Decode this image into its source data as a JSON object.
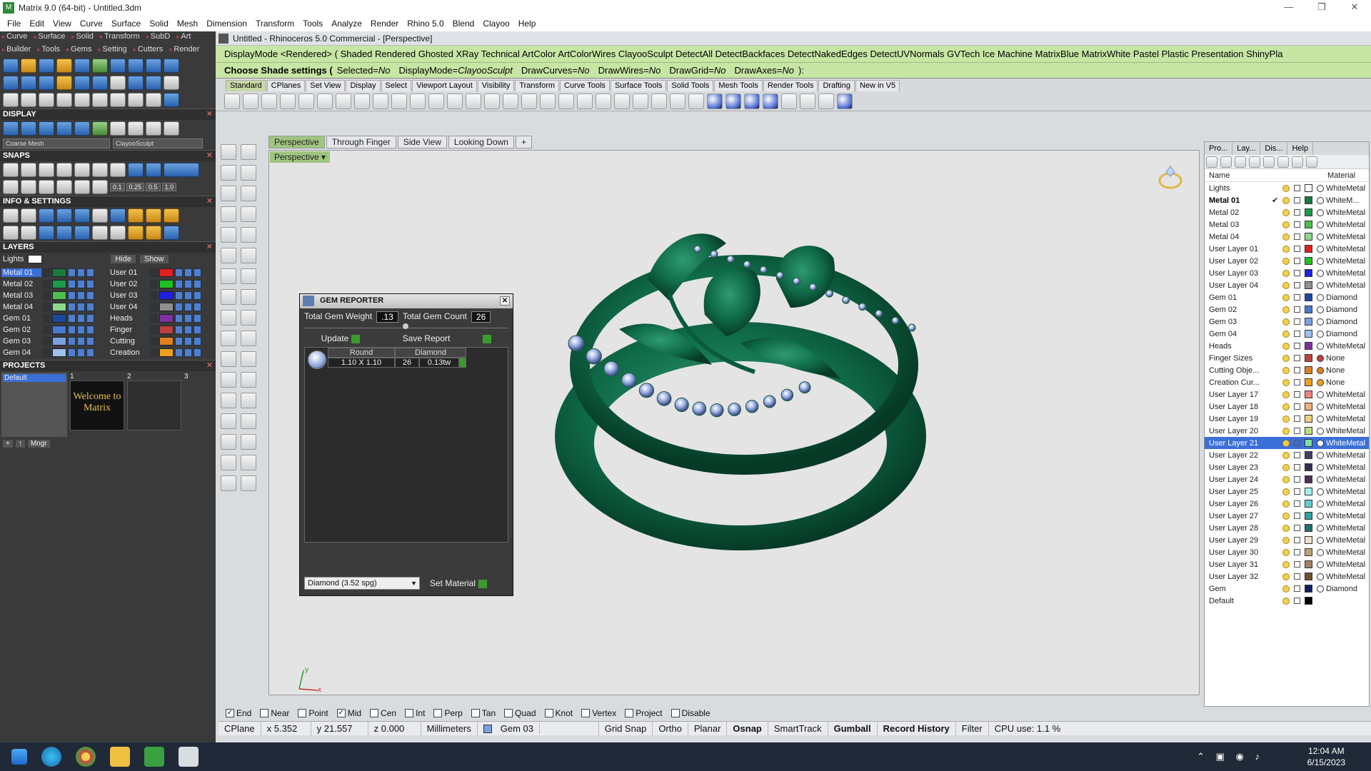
{
  "window": {
    "title": "Matrix 9.0 (64-bit) - Untitled.3dm",
    "minimize": "—",
    "maximize": "❐",
    "close": "✕"
  },
  "menu": [
    "File",
    "Edit",
    "View",
    "Curve",
    "Surface",
    "Solid",
    "Mesh",
    "Dimension",
    "Transform",
    "Tools",
    "Analyze",
    "Render",
    "Rhino 5.0",
    "Blend",
    "Clayoo",
    "Help"
  ],
  "left": {
    "tabs1": [
      "Curve",
      "Surface",
      "Solid",
      "Transform",
      "SubD",
      "Art"
    ],
    "tabs2": [
      "Builder",
      "Tools",
      "Gems",
      "Setting",
      "Cutters",
      "Render"
    ],
    "display_title": "DISPLAY",
    "mesh_dropdown": "Coarse Mesh",
    "mode_dropdown": "ClayooSculpt",
    "snaps_title": "SNAPS",
    "snap_values": [
      "0.1",
      "0.25",
      "0.5",
      "1.0"
    ],
    "info_title": "INFO & SETTINGS",
    "layers_title": "LAYERS",
    "lights_label": "Lights",
    "hide_label": "Hide",
    "show_label": "Show",
    "layers_left": [
      {
        "name": "Metal 01",
        "color": "#1a7a3a",
        "sel": true
      },
      {
        "name": "Metal 02",
        "color": "#1a9a4a"
      },
      {
        "name": "Metal 03",
        "color": "#4ac04a"
      },
      {
        "name": "Metal 04",
        "color": "#8ad88a"
      },
      {
        "name": "Gem 01",
        "color": "#1a4aa0"
      },
      {
        "name": "Gem 02",
        "color": "#4a7ad0"
      },
      {
        "name": "Gem 03",
        "color": "#7aa0e0"
      },
      {
        "name": "Gem 04",
        "color": "#a0c0f0"
      }
    ],
    "layers_right": [
      {
        "name": "User 01",
        "color": "#e02020"
      },
      {
        "name": "User 02",
        "color": "#20c020"
      },
      {
        "name": "User 03",
        "color": "#2020e0"
      },
      {
        "name": "User 04",
        "color": "#909090"
      },
      {
        "name": "Heads",
        "color": "#8030a0"
      },
      {
        "name": "Finger",
        "color": "#c04040"
      },
      {
        "name": "Cutting",
        "color": "#e08020"
      },
      {
        "name": "Creation",
        "color": "#f0a020"
      }
    ],
    "projects_title": "PROJECTS",
    "project_default": "Default",
    "project_tabs": [
      "1",
      "2",
      "3"
    ],
    "welcome": "Welcome to Matrix",
    "mngr": "Mngr"
  },
  "rhino": {
    "title": "Untitled - Rhinoceros 5.0 Commercial - [Perspective]",
    "history": "DisplayMode <Rendered> ( Shaded  Rendered  Ghosted  XRay  Technical  ArtColor  ArtColorWires  ClayooSculpt  DetectAll  DetectBackfaces  DetectNakedEdges  DetectUVNormals  GVTech  Ice  Machine  MatrixBlue  MatrixWhite  Pastel  Plastic  Presentation  ShinyPla",
    "prompt_lead": "Choose Shade settings (",
    "prompt_opts": [
      {
        "k": "Selected=",
        "v": "No"
      },
      {
        "k": "DisplayMode=",
        "v": "ClayooSculpt"
      },
      {
        "k": "DrawCurves=",
        "v": "No"
      },
      {
        "k": "DrawWires=",
        "v": "No"
      },
      {
        "k": "DrawGrid=",
        "v": "No"
      },
      {
        "k": "DrawAxes=",
        "v": "No"
      }
    ],
    "prompt_end": "):",
    "toolbar_tabs": [
      "Standard",
      "CPlanes",
      "Set View",
      "Display",
      "Select",
      "Viewport Layout",
      "Visibility",
      "Transform",
      "Curve Tools",
      "Surface Tools",
      "Solid Tools",
      "Mesh Tools",
      "Render Tools",
      "Drafting",
      "New in V5"
    ],
    "viewport_tabs": [
      "Perspective",
      "Through Finger",
      "Side View",
      "Looking Down"
    ],
    "viewport_add": "+",
    "viewport_label": "Perspective",
    "viewport_dropdown": "▾",
    "gem_reporter": {
      "title": "GEM REPORTER",
      "weight_label": "Total Gem Weight",
      "weight_value": ".13",
      "count_label": "Total Gem Count",
      "count_value": "26",
      "update": "Update",
      "save": "Save Report",
      "col_shape": "Round",
      "col_mat": "Diamond",
      "size": "1.10 X 1.10",
      "qty": "26",
      "tw": "0.13tw",
      "material_select": "Diamond    (3.52 spg)",
      "set_material": "Set Material"
    },
    "axis_y": "y",
    "axis_x": "x",
    "osnaps": [
      {
        "label": "End",
        "on": true
      },
      {
        "label": "Near",
        "on": false
      },
      {
        "label": "Point",
        "on": false
      },
      {
        "label": "Mid",
        "on": true
      },
      {
        "label": "Cen",
        "on": false
      },
      {
        "label": "Int",
        "on": false
      },
      {
        "label": "Perp",
        "on": false
      },
      {
        "label": "Tan",
        "on": false
      },
      {
        "label": "Quad",
        "on": false
      },
      {
        "label": "Knot",
        "on": false
      },
      {
        "label": "Vertex",
        "on": false
      },
      {
        "label": "Project",
        "on": false
      },
      {
        "label": "Disable",
        "on": false
      }
    ],
    "status": {
      "cplane": "CPlane",
      "x": "x 5.352",
      "y": "y 21.557",
      "z": "z 0.000",
      "units": "Millimeters",
      "layer": "Gem 03",
      "grid_snap": "Grid Snap",
      "ortho": "Ortho",
      "planar": "Planar",
      "osnap": "Osnap",
      "smarttrack": "SmartTrack",
      "gumball": "Gumball",
      "record": "Record History",
      "filter": "Filter",
      "cpu": "CPU use: 1.1 %"
    }
  },
  "layer_panel": {
    "tabs": [
      "Pro...",
      "Lay...",
      "Dis...",
      "Help"
    ],
    "col_name": "Name",
    "col_material": "Material",
    "layers": [
      {
        "name": "Lights",
        "color": "#ffffff",
        "mat": "WhiteMetal",
        "dot": "#ffffff"
      },
      {
        "name": "Metal 01",
        "color": "#1a7a3a",
        "mat": "WhiteM...",
        "dot": "#ffffff",
        "bold": true,
        "current": true
      },
      {
        "name": "Metal 02",
        "color": "#1a9a4a",
        "mat": "WhiteMetal",
        "dot": "#ffffff"
      },
      {
        "name": "Metal 03",
        "color": "#4ac04a",
        "mat": "WhiteMetal",
        "dot": "#ffffff"
      },
      {
        "name": "Metal 04",
        "color": "#8ad88a",
        "mat": "WhiteMetal",
        "dot": "#ffffff"
      },
      {
        "name": "User Layer 01",
        "color": "#e02020",
        "mat": "WhiteMetal",
        "dot": "#ffffff"
      },
      {
        "name": "User Layer 02",
        "color": "#20c020",
        "mat": "WhiteMetal",
        "dot": "#ffffff"
      },
      {
        "name": "User Layer 03",
        "color": "#2020e0",
        "mat": "WhiteMetal",
        "dot": "#ffffff"
      },
      {
        "name": "User Layer 04",
        "color": "#909090",
        "mat": "WhiteMetal",
        "dot": "#ffffff"
      },
      {
        "name": "Gem 01",
        "color": "#1a4aa0",
        "mat": "Diamond",
        "dot": "#ffffff"
      },
      {
        "name": "Gem 02",
        "color": "#4a7ad0",
        "mat": "Diamond",
        "dot": "#ffffff"
      },
      {
        "name": "Gem 03",
        "color": "#7aa0e0",
        "mat": "Diamond",
        "dot": "#ffffff"
      },
      {
        "name": "Gem 04",
        "color": "#a0c0f0",
        "mat": "Diamond",
        "dot": "#ffffff"
      },
      {
        "name": "Heads",
        "color": "#8030a0",
        "mat": "WhiteMetal",
        "dot": "#ffffff"
      },
      {
        "name": "Finger Sizes",
        "color": "#c04040",
        "mat": "None",
        "dot": "#c04040"
      },
      {
        "name": "Cutting Obje...",
        "color": "#e08020",
        "mat": "None",
        "dot": "#e08020"
      },
      {
        "name": "Creation Cur...",
        "color": "#f0a020",
        "mat": "None",
        "dot": "#f0a020"
      },
      {
        "name": "User Layer 17",
        "color": "#f08080",
        "mat": "WhiteMetal",
        "dot": "#ffffff"
      },
      {
        "name": "User Layer 18",
        "color": "#f0b080",
        "mat": "WhiteMetal",
        "dot": "#ffffff"
      },
      {
        "name": "User Layer 19",
        "color": "#f0d080",
        "mat": "WhiteMetal",
        "dot": "#ffffff"
      },
      {
        "name": "User Layer 20",
        "color": "#c0e080",
        "mat": "WhiteMetal",
        "dot": "#ffffff"
      },
      {
        "name": "User Layer 21",
        "color": "#80e0a0",
        "mat": "WhiteMetal",
        "dot": "#ffffff",
        "sel": true
      },
      {
        "name": "User Layer 22",
        "color": "#404060",
        "mat": "WhiteMetal",
        "dot": "#ffffff"
      },
      {
        "name": "User Layer 23",
        "color": "#303050",
        "mat": "WhiteMetal",
        "dot": "#ffffff"
      },
      {
        "name": "User Layer 24",
        "color": "#503050",
        "mat": "WhiteMetal",
        "dot": "#ffffff"
      },
      {
        "name": "User Layer 25",
        "color": "#a0f0f0",
        "mat": "WhiteMetal",
        "dot": "#ffffff"
      },
      {
        "name": "User Layer 26",
        "color": "#60d0d0",
        "mat": "WhiteMetal",
        "dot": "#ffffff"
      },
      {
        "name": "User Layer 27",
        "color": "#30a0a0",
        "mat": "WhiteMetal",
        "dot": "#ffffff"
      },
      {
        "name": "User Layer 28",
        "color": "#207070",
        "mat": "WhiteMetal",
        "dot": "#ffffff"
      },
      {
        "name": "User Layer 29",
        "color": "#f0e0d0",
        "mat": "WhiteMetal",
        "dot": "#ffffff"
      },
      {
        "name": "User Layer 30",
        "color": "#c0a080",
        "mat": "WhiteMetal",
        "dot": "#ffffff"
      },
      {
        "name": "User Layer 31",
        "color": "#a08060",
        "mat": "WhiteMetal",
        "dot": "#ffffff"
      },
      {
        "name": "User Layer 32",
        "color": "#705030",
        "mat": "WhiteMetal",
        "dot": "#ffffff"
      },
      {
        "name": "Gem",
        "color": "#102060",
        "mat": "Diamond",
        "dot": "#ffffff"
      },
      {
        "name": "Default",
        "color": "#000000",
        "mat": "",
        "dot": ""
      }
    ]
  },
  "taskbar": {
    "time": "12:04 AM",
    "date": "6/15/2023"
  },
  "colors": {
    "ring": "#0f6a48",
    "gem": "#9fb4e6",
    "cmd_bg": "#c7e6a4",
    "tab_active": "#9fc57f",
    "layer_sel": "#3b6fd8"
  }
}
